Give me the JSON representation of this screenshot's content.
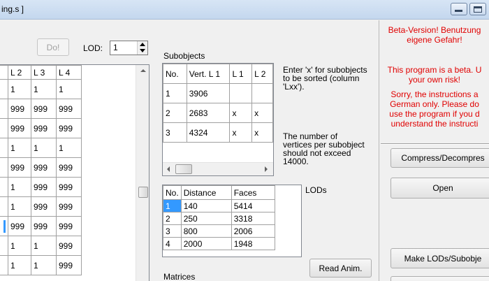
{
  "window": {
    "title": "ing.s ]",
    "minimize_icon": "minimize-icon",
    "restore_icon": "restore-icon"
  },
  "toolbar": {
    "do_label": "Do!",
    "lod_label": "LOD:",
    "lod_value": "1"
  },
  "main_table": {
    "headers": [
      "L 2",
      "L 3",
      "L 4"
    ],
    "rows": [
      [
        "1",
        "1",
        "1"
      ],
      [
        "999",
        "999",
        "999"
      ],
      [
        "999",
        "999",
        "999"
      ],
      [
        "1",
        "1",
        "1"
      ],
      [
        "999",
        "999",
        "999"
      ],
      [
        "1",
        "999",
        "999"
      ],
      [
        "1",
        "999",
        "999"
      ],
      [
        "999",
        "999",
        "999"
      ],
      [
        "1",
        "1",
        "999"
      ],
      [
        "1",
        "1",
        "999"
      ]
    ],
    "selected_row_marker_row": 7
  },
  "subobjects": {
    "label": "Subobjects",
    "headers": [
      "No.",
      "Vert. L 1",
      "L 1",
      "L 2"
    ],
    "rows": [
      [
        "1",
        "3906",
        "",
        ""
      ],
      [
        "2",
        "2683",
        "x",
        "x"
      ],
      [
        "3",
        "4324",
        "x",
        "x"
      ]
    ],
    "hint_sort": "Enter 'x' for subobjects to be sorted (column 'Lxx').",
    "hint_sort_lines": [
      "Enter 'x' for subobjects",
      "to be sorted (column",
      "'Lxx')."
    ],
    "hint_vertices_lines": [
      "The number of",
      "vertices per subobject",
      "should not exceed",
      "14000."
    ]
  },
  "lods": {
    "label": "LODs",
    "headers": [
      "No.",
      "Distance",
      "Faces"
    ],
    "rows": [
      [
        "1",
        "140",
        "5414"
      ],
      [
        "2",
        "250",
        "3318"
      ],
      [
        "3",
        "800",
        "2006"
      ],
      [
        "4",
        "2000",
        "1948"
      ]
    ],
    "read_anim_label": "Read Anim.",
    "matrices_label": "Matrices"
  },
  "right_panel": {
    "beta_lines": [
      "Beta-Version! Benutzung",
      "eigene Gefahr!"
    ],
    "beta_en_lines": [
      "This program is a beta. U",
      "your own risk!"
    ],
    "sorry_lines": [
      "Sorry, the instructions a",
      "German only. Please do",
      "use the program if you d",
      "understand the instructi"
    ],
    "compress_label": "Compress/Decompres",
    "open_label": "Open",
    "make_lods_label": "Make LODs/Subobje"
  },
  "colors": {
    "accent_selection": "#3399ff",
    "warning_text": "#e00000"
  }
}
